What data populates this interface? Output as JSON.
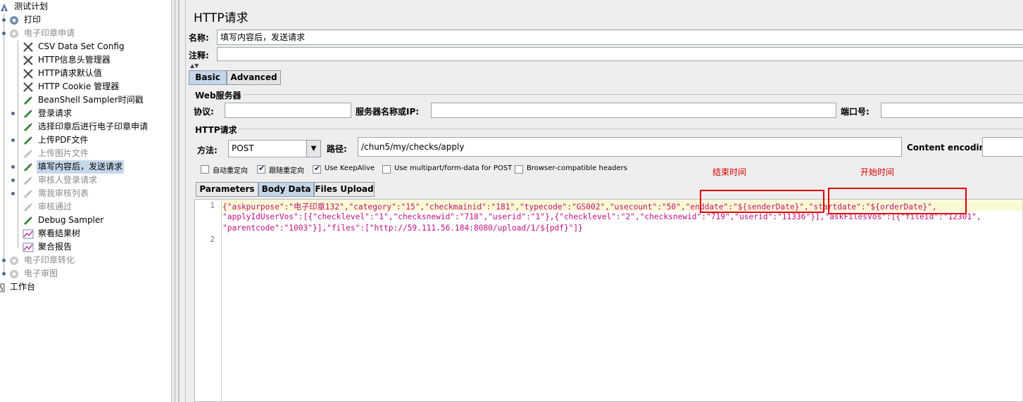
{
  "tree": {
    "items": [
      {
        "label": "测试计划",
        "icon": "test-plan-icon"
      },
      {
        "label": "打印",
        "icon": "thread-group-icon"
      },
      {
        "label": "电子印章申请",
        "icon": "thread-group-icon"
      },
      {
        "label": "CSV Data Set Config",
        "icon": "config-element-icon"
      },
      {
        "label": "HTTP信息头管理器",
        "icon": "config-element-icon"
      },
      {
        "label": "HTTP请求默认值",
        "icon": "config-element-icon"
      },
      {
        "label": "HTTP Cookie 管理器",
        "icon": "config-element-icon"
      },
      {
        "label": "BeanShell Sampler时间戳",
        "icon": "sampler-icon"
      },
      {
        "label": "登录请求",
        "icon": "sampler-icon"
      },
      {
        "label": "选择印章后进行电子印章申请",
        "icon": "sampler-icon"
      },
      {
        "label": "上传PDF文件",
        "icon": "sampler-icon"
      },
      {
        "label": "上传图片文件",
        "icon": "sampler-icon"
      },
      {
        "label": "填写内容后，发送请求",
        "icon": "sampler-icon"
      },
      {
        "label": "审核人登录请求",
        "icon": "sampler-icon"
      },
      {
        "label": "需我审核列表",
        "icon": "sampler-icon"
      },
      {
        "label": "审核通过",
        "icon": "sampler-icon"
      },
      {
        "label": "Debug Sampler",
        "icon": "sampler-icon"
      },
      {
        "label": "察看结果树",
        "icon": "listener-icon"
      },
      {
        "label": "聚合报告",
        "icon": "listener-icon"
      },
      {
        "label": "电子印章转化",
        "icon": "thread-group-icon"
      },
      {
        "label": "电子审图",
        "icon": "thread-group-icon"
      },
      {
        "label": "工作台",
        "icon": "workbench-icon"
      }
    ]
  },
  "panel": {
    "title": "HTTP请求",
    "name_label": "名称:",
    "name_value": "填写内容后，发送请求",
    "comment_label": "注释:",
    "tabs": [
      "Basic",
      "Advanced"
    ],
    "web_server": {
      "title": "Web服务器",
      "protocol_label": "协议:",
      "server_label": "服务器名称或IP:",
      "port_label": "端口号:"
    },
    "http_request": {
      "title": "HTTP请求",
      "method_label": "方法:",
      "method_value": "POST",
      "path_label": "路径:",
      "path_value": "/chun5/my/checks/apply",
      "encoding_label": "Content encoding:"
    },
    "checkboxes": [
      {
        "label": "自动重定向",
        "checked": false
      },
      {
        "label": "跟随重定向",
        "checked": true
      },
      {
        "label": "Use KeepAlive",
        "checked": true
      },
      {
        "label": "Use multipart/form-data for POST",
        "checked": false
      },
      {
        "label": "Browser-compatible headers",
        "checked": false
      }
    ],
    "annotations": {
      "end_time": "结束时间",
      "start_time": "开始时间"
    },
    "body_tabs": [
      "Parameters",
      "Body Data",
      "Files Upload"
    ],
    "body": {
      "line_numbers": [
        "1",
        "2"
      ],
      "lines": [
        "{\"askpurpose\":\"电子印章132\",\"category\":\"15\",\"checkmainid\":\"181\",\"typecode\":\"GS002\",\"usecount\":\"50\",\"enddate\":\"${senderDate}\",\"startdate\":\"${orderDate}\",",
        "\"applyIdUserVos\":[{\"checklevel\":\"1\",\"checksnewid\":\"718\",\"userid\":\"1\"},{\"checklevel\":\"2\",\"checksnewid\":\"719\",\"userid\":\"11336\"}],\"askFilesVos\":[{\"fileid\":\"12301\",",
        "\"parentcode\":\"1003\"}],\"files\":[\"http://59.111.56.184:8080/upload/1/${pdf}\"]}"
      ]
    }
  },
  "colors": {
    "accent": "#c4d6e8",
    "annotation": "#d40000",
    "code": "#c0117f"
  }
}
